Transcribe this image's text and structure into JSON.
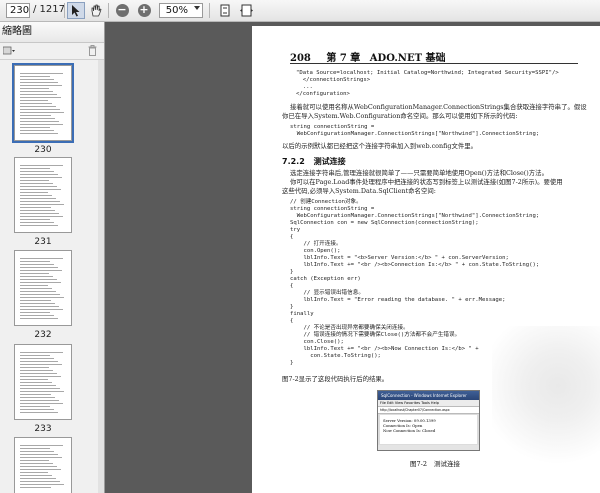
{
  "toolbar": {
    "page_number": "230",
    "page_total": "/ 1217",
    "zoom": "50%"
  },
  "sidebar": {
    "title": "縮略圖",
    "thumbnails": [
      {
        "label": "230",
        "selected": true
      },
      {
        "label": "231",
        "selected": false
      },
      {
        "label": "232",
        "selected": false
      },
      {
        "label": "233",
        "selected": false
      }
    ]
  },
  "page": {
    "header_num": "208",
    "header_chapter": "第 7 章",
    "header_title": "ADO.NET 基础",
    "code1": [
      "\"Data Source=localhost; Initial Catalog=Northwind; Integrated Security=SSPI\"/>",
      "  </connectionStrings>",
      "  ...",
      "</configuration>"
    ],
    "para1": [
      "接着就可以使用名称从WebConfigurationManager.ConnectionStrings集合获取连接字符串了。假设",
      "你已在导入System.Web.Configuration命名空间。那么可以使用如下所示的代码:"
    ],
    "code2": [
      "string connectionString =",
      "  WebConfigurationManager.ConnectionStrings[\"Northwind\"].ConnectionString;"
    ],
    "para2": "以后的示例默认都已经把这个连接字符串加入到web.config文件里。",
    "section_num": "7.2.2",
    "section_title": "测试连接",
    "para3": [
      "选定连接字符串后,管理连接就很简单了——只需要简单地使用Open()方法和Close()方法。",
      "你可以在Page.Load事件处理程序中把连接的状态写到标签上以测试连接(如图7-2所示)。要使用",
      "这些代码,必须导入System.Data.SqlClient命名空间:"
    ],
    "code3": [
      "// 创建Connection对象。",
      "string connectionString =",
      "  WebConfigurationManager.ConnectionStrings[\"Northwind\"].ConnectionString;",
      "SqlConnection con = new SqlConnection(connectionString);",
      "try",
      "{",
      "    // 打开连接。",
      "    con.Open();",
      "    lblInfo.Text = \"<b>Server Version:</b> \" + con.ServerVersion;",
      "    lblInfo.Text += \"<br /><b>Connection Is:</b> \" + con.State.ToString();",
      "}",
      "catch (Exception err)",
      "{",
      "    // 显示错误出错信息。",
      "    lblInfo.Text = \"Error reading the database. \" + err.Message;",
      "}",
      "finally",
      "{",
      "    // 不论是否出现异常都要确保关闭连接。",
      "    // 错误连接的情况下需要确保Close()方法都不会产生错误。",
      "    con.Close();",
      "    lblInfo.Text += \"<br /><b>Now Connection Is:</b> \" +",
      "      con.State.ToString();",
      "}"
    ],
    "para4": "图7-2显示了这段代码执行后的结果。",
    "figure": {
      "window_title": "SqlConnection - Windows Internet Explorer",
      "menu": "File  Edit  View  Favorites  Tools  Help",
      "address": "http://localhost/Chapter07/Connection.aspx",
      "line1": "Server Version: 09.00.1399",
      "line2": "Connection Is: Open",
      "line3": "Now Connection Is: Closed",
      "caption_num": "图7-2",
      "caption_text": "测试连接"
    }
  }
}
